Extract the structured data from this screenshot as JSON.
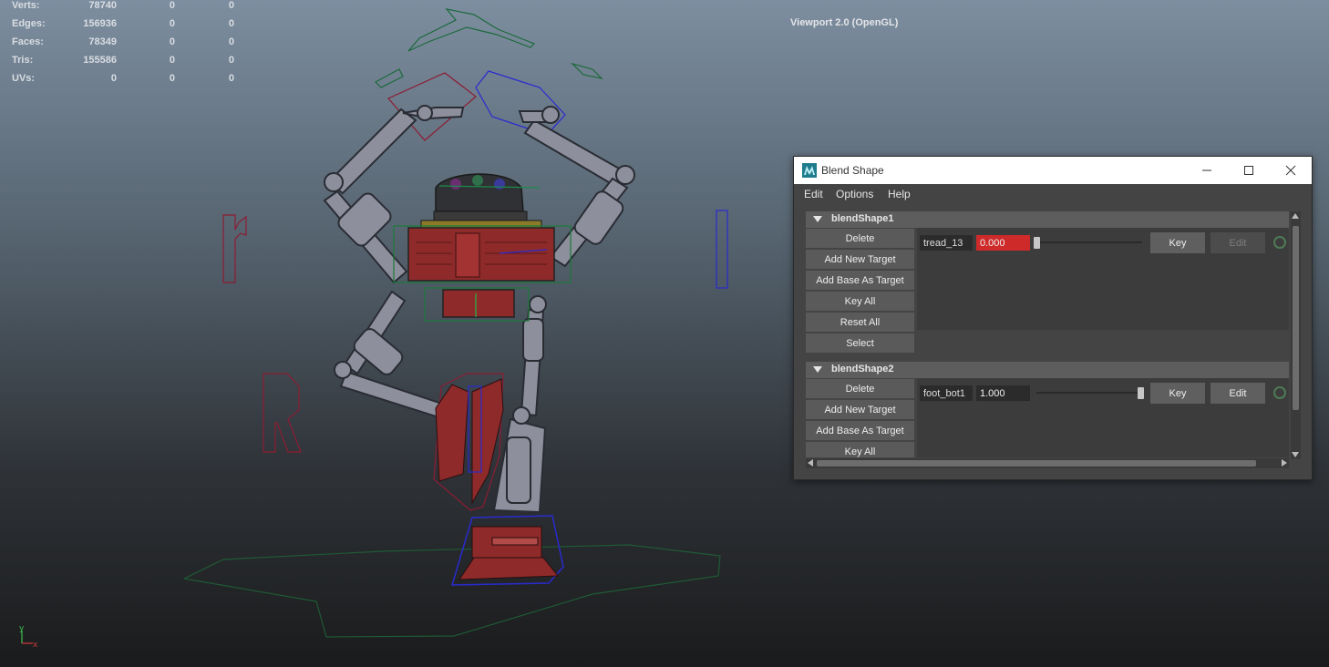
{
  "hud": {
    "rows": [
      {
        "label": "Verts:",
        "v1": "78740",
        "v2": "0",
        "v3": "0"
      },
      {
        "label": "Edges:",
        "v1": "156936",
        "v2": "0",
        "v3": "0"
      },
      {
        "label": "Faces:",
        "v1": "78349",
        "v2": "0",
        "v3": "0"
      },
      {
        "label": "Tris:",
        "v1": "155586",
        "v2": "0",
        "v3": "0"
      },
      {
        "label": "UVs:",
        "v1": "0",
        "v2": "0",
        "v3": "0"
      }
    ],
    "renderer": "Viewport 2.0 (OpenGL)"
  },
  "viewport": {
    "letters": {
      "r": "r",
      "R": "R"
    },
    "axis": {
      "y": "y",
      "x": "x"
    }
  },
  "window": {
    "title": "Blend Shape",
    "icon": "maya-app-icon",
    "controls": {
      "minimize": "—",
      "maximize": "☐",
      "close": "✕"
    },
    "menu": [
      "Edit",
      "Options",
      "Help"
    ],
    "sections": [
      {
        "name": "blendShape1",
        "buttons": [
          "Delete",
          "Add New Target",
          "Add Base As Target",
          "Key All",
          "Reset All",
          "Select"
        ],
        "target": {
          "name": "tread_13",
          "value": "0.000",
          "weight": 0.0,
          "key_label": "Key",
          "edit_label": "Edit",
          "edit_enabled": false,
          "value_color": "#cf2a2a"
        }
      },
      {
        "name": "blendShape2",
        "buttons": [
          "Delete",
          "Add New Target",
          "Add Base As Target",
          "Key All"
        ],
        "target": {
          "name": "foot_bot1",
          "value": "1.000",
          "weight": 1.0,
          "key_label": "Key",
          "edit_label": "Edit",
          "edit_enabled": true,
          "value_color": "#2b2b2b"
        }
      }
    ]
  }
}
